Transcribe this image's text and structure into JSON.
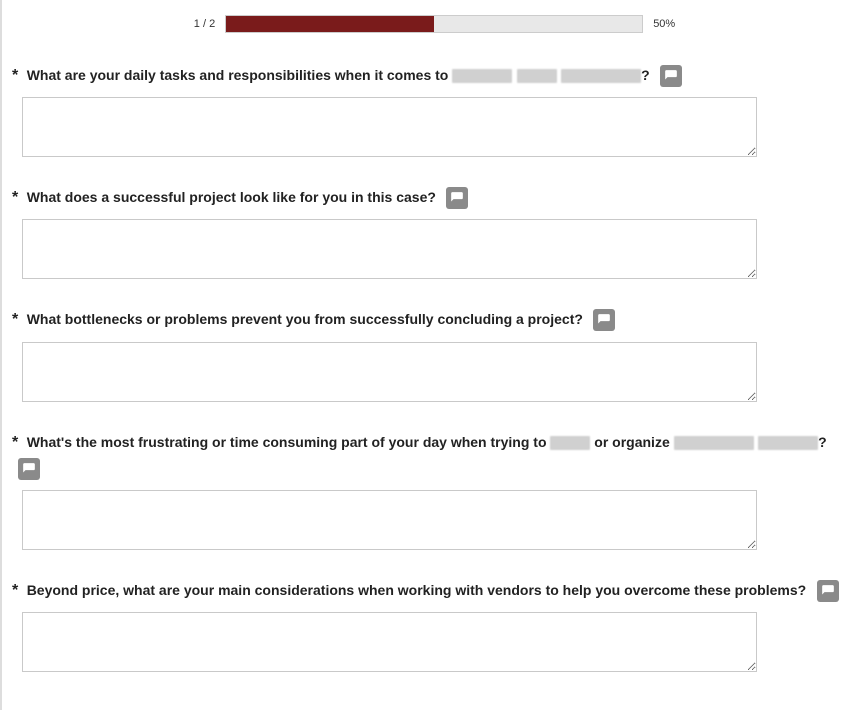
{
  "progress": {
    "pageLabel": "1 / 2",
    "percentLabel": "50%",
    "percentValue": 50
  },
  "questions": [
    {
      "required": "*",
      "textPre": "What are your daily tasks and responsibilities when it comes to ",
      "textPost": "?",
      "hasRedactedMiddle": true,
      "hasRedactedTail": false,
      "value": ""
    },
    {
      "required": "*",
      "textPre": "What does a successful project look like for you in this case?",
      "textPost": "",
      "hasRedactedMiddle": false,
      "hasRedactedTail": false,
      "value": ""
    },
    {
      "required": "*",
      "textPre": "What bottlenecks or problems prevent you from successfully concluding a project?",
      "textPost": "",
      "hasRedactedMiddle": false,
      "hasRedactedTail": false,
      "value": ""
    },
    {
      "required": "*",
      "textPre": "What's the most frustrating or time consuming part of your day when trying to ",
      "textMid": " or organize ",
      "textPost": "?",
      "hasRedactedMiddle": true,
      "hasRedactedTail": true,
      "value": ""
    },
    {
      "required": "*",
      "textPre": "Beyond price, what are your main considerations when working with vendors to help you overcome these problems?",
      "textPost": "",
      "hasRedactedMiddle": false,
      "hasRedactedTail": false,
      "value": ""
    }
  ]
}
